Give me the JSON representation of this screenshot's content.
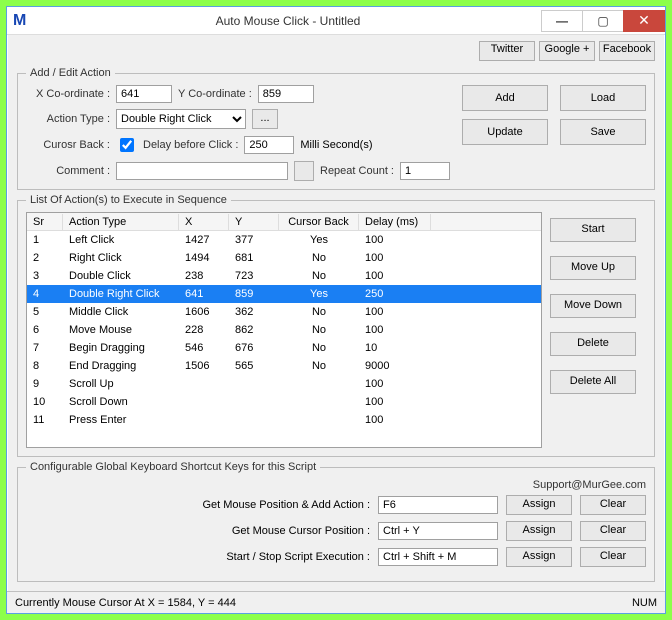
{
  "titlebar": {
    "logo": "M",
    "title": "Auto Mouse Click - Untitled"
  },
  "socials": {
    "twitter": "Twitter",
    "google": "Google +",
    "facebook": "Facebook"
  },
  "form": {
    "legend": "Add / Edit Action",
    "xlabel": "X Co-ordinate :",
    "xval": "641",
    "ylabel": "Y Co-ordinate :",
    "yval": "859",
    "atlabel": "Action Type :",
    "atval": "Double Right Click",
    "ellipsis": "...",
    "cblabel": "Curosr Back :",
    "dblabel": "Delay before Click :",
    "dbval": "250",
    "dbunit": "Milli Second(s)",
    "cmlabel": "Comment :",
    "cmval": "",
    "rclabel": "Repeat Count :",
    "rcval": "1",
    "add": "Add",
    "load": "Load",
    "update": "Update",
    "save": "Save"
  },
  "list": {
    "legend": "List Of Action(s) to Execute in Sequence",
    "headers": {
      "sr": "Sr",
      "type": "Action Type",
      "x": "X",
      "y": "Y",
      "cb": "Cursor Back",
      "d": "Delay (ms)"
    },
    "rows": [
      {
        "sr": "1",
        "type": "Left Click",
        "x": "1427",
        "y": "377",
        "cb": "Yes",
        "d": "100",
        "sel": false
      },
      {
        "sr": "2",
        "type": "Right Click",
        "x": "1494",
        "y": "681",
        "cb": "No",
        "d": "100",
        "sel": false
      },
      {
        "sr": "3",
        "type": "Double Click",
        "x": "238",
        "y": "723",
        "cb": "No",
        "d": "100",
        "sel": false
      },
      {
        "sr": "4",
        "type": "Double Right Click",
        "x": "641",
        "y": "859",
        "cb": "Yes",
        "d": "250",
        "sel": true
      },
      {
        "sr": "5",
        "type": "Middle Click",
        "x": "1606",
        "y": "362",
        "cb": "No",
        "d": "100",
        "sel": false
      },
      {
        "sr": "6",
        "type": "Move Mouse",
        "x": "228",
        "y": "862",
        "cb": "No",
        "d": "100",
        "sel": false
      },
      {
        "sr": "7",
        "type": "Begin Dragging",
        "x": "546",
        "y": "676",
        "cb": "No",
        "d": "10",
        "sel": false
      },
      {
        "sr": "8",
        "type": "End Dragging",
        "x": "1506",
        "y": "565",
        "cb": "No",
        "d": "9000",
        "sel": false
      },
      {
        "sr": "9",
        "type": "Scroll Up",
        "x": "",
        "y": "",
        "cb": "",
        "d": "100",
        "sel": false
      },
      {
        "sr": "10",
        "type": "Scroll Down",
        "x": "",
        "y": "",
        "cb": "",
        "d": "100",
        "sel": false
      },
      {
        "sr": "11",
        "type": "Press Enter",
        "x": "",
        "y": "",
        "cb": "",
        "d": "100",
        "sel": false
      }
    ],
    "btns": {
      "start": "Start",
      "moveup": "Move Up",
      "movedown": "Move Down",
      "delete": "Delete",
      "deleteall": "Delete All"
    }
  },
  "shortcuts": {
    "legend": "Configurable Global Keyboard Shortcut Keys for this Script",
    "support": "Support@MurGee.com",
    "rows": [
      {
        "label": "Get Mouse Position & Add Action :",
        "val": "F6"
      },
      {
        "label": "Get Mouse Cursor Position :",
        "val": "Ctrl + Y"
      },
      {
        "label": "Start / Stop Script Execution :",
        "val": "Ctrl + Shift + M"
      }
    ],
    "assign": "Assign",
    "clear": "Clear"
  },
  "status": {
    "text": "Currently Mouse Cursor At X = 1584, Y = 444",
    "num": "NUM"
  }
}
